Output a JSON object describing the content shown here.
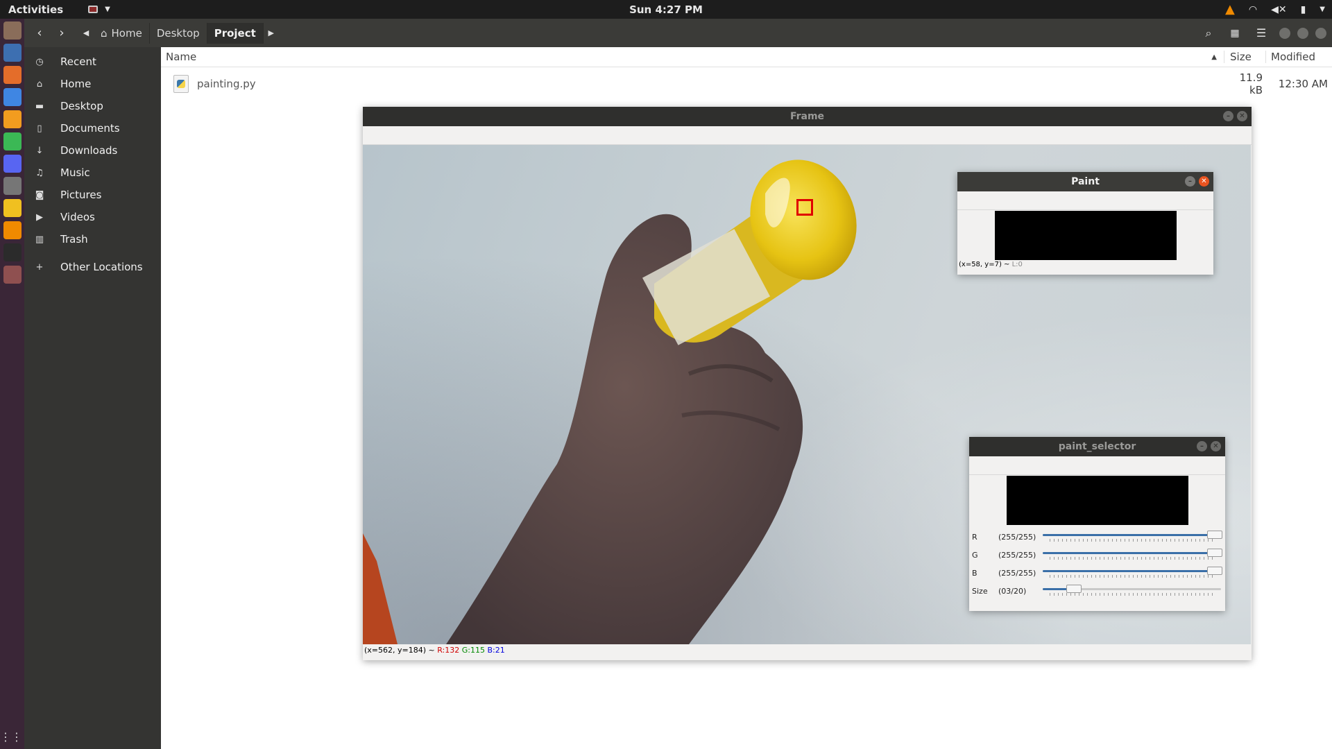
{
  "topbar": {
    "activities": "Activities",
    "clock": "Sun  4:27 PM",
    "icons": [
      "vlc-icon",
      "wifi-icon",
      "volume-mute-icon",
      "battery-icon",
      "chevron-down-icon"
    ]
  },
  "dock": {
    "apps": [
      {
        "name": "files",
        "color": "#8a6d5a"
      },
      {
        "name": "text-editor",
        "color": "#3d6fb1"
      },
      {
        "name": "software-center",
        "color": "#e46d2a"
      },
      {
        "name": "chromium",
        "color": "#3f86e3"
      },
      {
        "name": "sublime",
        "color": "#f29c1f"
      },
      {
        "name": "spotify",
        "color": "#3bb855"
      },
      {
        "name": "discord",
        "color": "#5865f2"
      },
      {
        "name": "photos",
        "color": "#767676"
      },
      {
        "name": "notes",
        "color": "#f0c020"
      },
      {
        "name": "vlc",
        "color": "#f08a00"
      },
      {
        "name": "terminal",
        "color": "#2b2b2b"
      },
      {
        "name": "image-viewer",
        "color": "#8f5050"
      }
    ],
    "grid": "⋮⋮⋮"
  },
  "headerbar": {
    "back": "‹",
    "forward": "›",
    "breadcrumbs": [
      {
        "label": "Home"
      },
      {
        "label": "Desktop"
      },
      {
        "label": "Project"
      }
    ]
  },
  "sidebar": {
    "items": [
      {
        "label": "Recent",
        "icon": "clock-icon",
        "glyph": "◷"
      },
      {
        "label": "Home",
        "icon": "home-icon",
        "glyph": "⌂"
      },
      {
        "label": "Desktop",
        "icon": "folder-icon",
        "glyph": "▬"
      },
      {
        "label": "Documents",
        "icon": "document-icon",
        "glyph": "▯"
      },
      {
        "label": "Downloads",
        "icon": "download-icon",
        "glyph": "↓"
      },
      {
        "label": "Music",
        "icon": "music-icon",
        "glyph": "♫"
      },
      {
        "label": "Pictures",
        "icon": "camera-icon",
        "glyph": "◙"
      },
      {
        "label": "Videos",
        "icon": "video-icon",
        "glyph": "▶"
      },
      {
        "label": "Trash",
        "icon": "trash-icon",
        "glyph": "▥"
      }
    ],
    "other": {
      "label": "Other Locations",
      "glyph": "+"
    }
  },
  "filelist": {
    "columns": {
      "name": "Name",
      "size": "Size",
      "modified": "Modified"
    },
    "rows": [
      {
        "name": "painting.py",
        "size": "11.9 kB",
        "modified": "12:30 AM"
      }
    ]
  },
  "frame_window": {
    "title": "Frame",
    "status": {
      "coords": "(x=562, y=184) ~ ",
      "r": "R:132",
      "g": "G:115",
      "b": "B:21"
    }
  },
  "paint_window": {
    "title": "Paint",
    "status": {
      "coords": "(x=58, y=7) ~ ",
      "l": "L:0"
    }
  },
  "selector_window": {
    "title": "paint_selector",
    "trackbars": [
      {
        "label": "R",
        "value": "(255/255)",
        "fraction": 1.0
      },
      {
        "label": "G",
        "value": "(255/255)",
        "fraction": 1.0
      },
      {
        "label": "B",
        "value": "(255/255)",
        "fraction": 1.0
      },
      {
        "label": "Size",
        "value": "(03/20)",
        "fraction": 0.15
      }
    ]
  },
  "colors": {
    "status_r": "#d00000",
    "status_g": "#008800",
    "status_b": "#0000dd",
    "status_l": "#888888"
  }
}
